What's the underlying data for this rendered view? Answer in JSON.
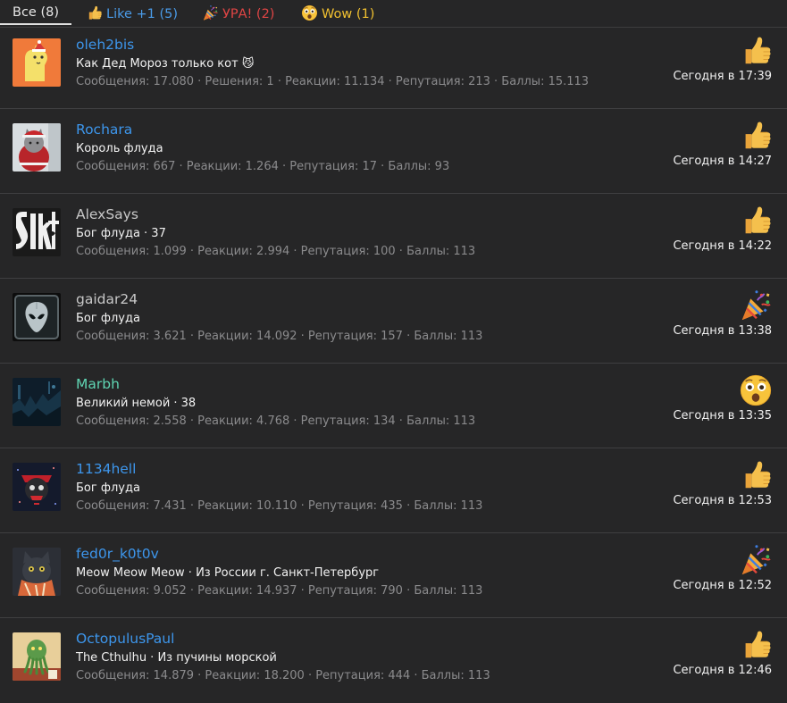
{
  "tabs": [
    {
      "label": "Все (8)",
      "color": "#e6e6e6",
      "icon": "",
      "active": true
    },
    {
      "label": "Like +1 (5)",
      "color": "#4a9be8",
      "icon": "thumbs-up-icon",
      "active": false
    },
    {
      "label": "УРА! (2)",
      "color": "#e04545",
      "icon": "party-popper-icon",
      "active": false
    },
    {
      "label": "Wow (1)",
      "color": "#f0c030",
      "icon": "wow-face-icon",
      "active": false
    }
  ],
  "reactions": [
    {
      "username": "oleh2bis",
      "username_color": "#3d96ec",
      "title": "Как Дед Мороз только кот 😼",
      "stats": "Сообщения: 17.080 · Решения: 1 · Реакции: 11.134 · Репутация: 213 · Баллы: 15.113",
      "time": "Сегодня в 17:39",
      "reaction_icon": "thumbs-up-icon",
      "avatar": "llama-avatar"
    },
    {
      "username": "Rochara",
      "username_color": "#3d96ec",
      "title": "Король флуда",
      "stats": "Сообщения: 667 · Реакции: 1.264 · Репутация: 17 · Баллы: 93",
      "time": "Сегодня в 14:27",
      "reaction_icon": "thumbs-up-icon",
      "avatar": "cat-santa-avatar"
    },
    {
      "username": "AlexSays",
      "username_color": "#c8c8c8",
      "title": "Бог флуда · 37",
      "stats": "Сообщения: 1.099 · Реакции: 2.994 · Репутация: 100 · Баллы: 113",
      "time": "Сегодня в 14:22",
      "reaction_icon": "thumbs-up-icon",
      "avatar": "logo-avatar"
    },
    {
      "username": "gaidar24",
      "username_color": "#c8c8c8",
      "title": "Бог флуда",
      "stats": "Сообщения: 3.621 · Реакции: 14.092 · Репутация: 157 · Баллы: 113",
      "time": "Сегодня в 13:38",
      "reaction_icon": "party-popper-icon",
      "avatar": "alien-avatar"
    },
    {
      "username": "Marbh",
      "username_color": "#5fd4b2",
      "title": "Великий немой · 38",
      "stats": "Сообщения: 2.558 · Реакции: 4.768 · Репутация: 134 · Баллы: 113",
      "time": "Сегодня в 13:35",
      "reaction_icon": "wow-face-icon",
      "avatar": "dark-scene-avatar"
    },
    {
      "username": "1134hell",
      "username_color": "#3d96ec",
      "title": "Бог флуда",
      "stats": "Сообщения: 7.431 · Реакции: 10.110 · Репутация: 435 · Баллы: 113",
      "time": "Сегодня в 12:53",
      "reaction_icon": "thumbs-up-icon",
      "avatar": "skull-avatar"
    },
    {
      "username": "fed0r_k0t0v",
      "username_color": "#3d96ec",
      "title": "Meow Meow Meow · Из России г. Санкт-Петербург",
      "stats": "Сообщения: 9.052 · Реакции: 14.937 · Репутация: 790 · Баллы: 113",
      "time": "Сегодня в 12:52",
      "reaction_icon": "party-popper-icon",
      "avatar": "cat-scarf-avatar"
    },
    {
      "username": "OctopulusPaul",
      "username_color": "#3d96ec",
      "title": "The Cthulhu · Из пучины морской",
      "stats": "Сообщения: 14.879 · Реакции: 18.200 · Репутация: 444 · Баллы: 113",
      "time": "Сегодня в 12:46",
      "reaction_icon": "thumbs-up-icon",
      "avatar": "cthulhu-avatar"
    }
  ]
}
